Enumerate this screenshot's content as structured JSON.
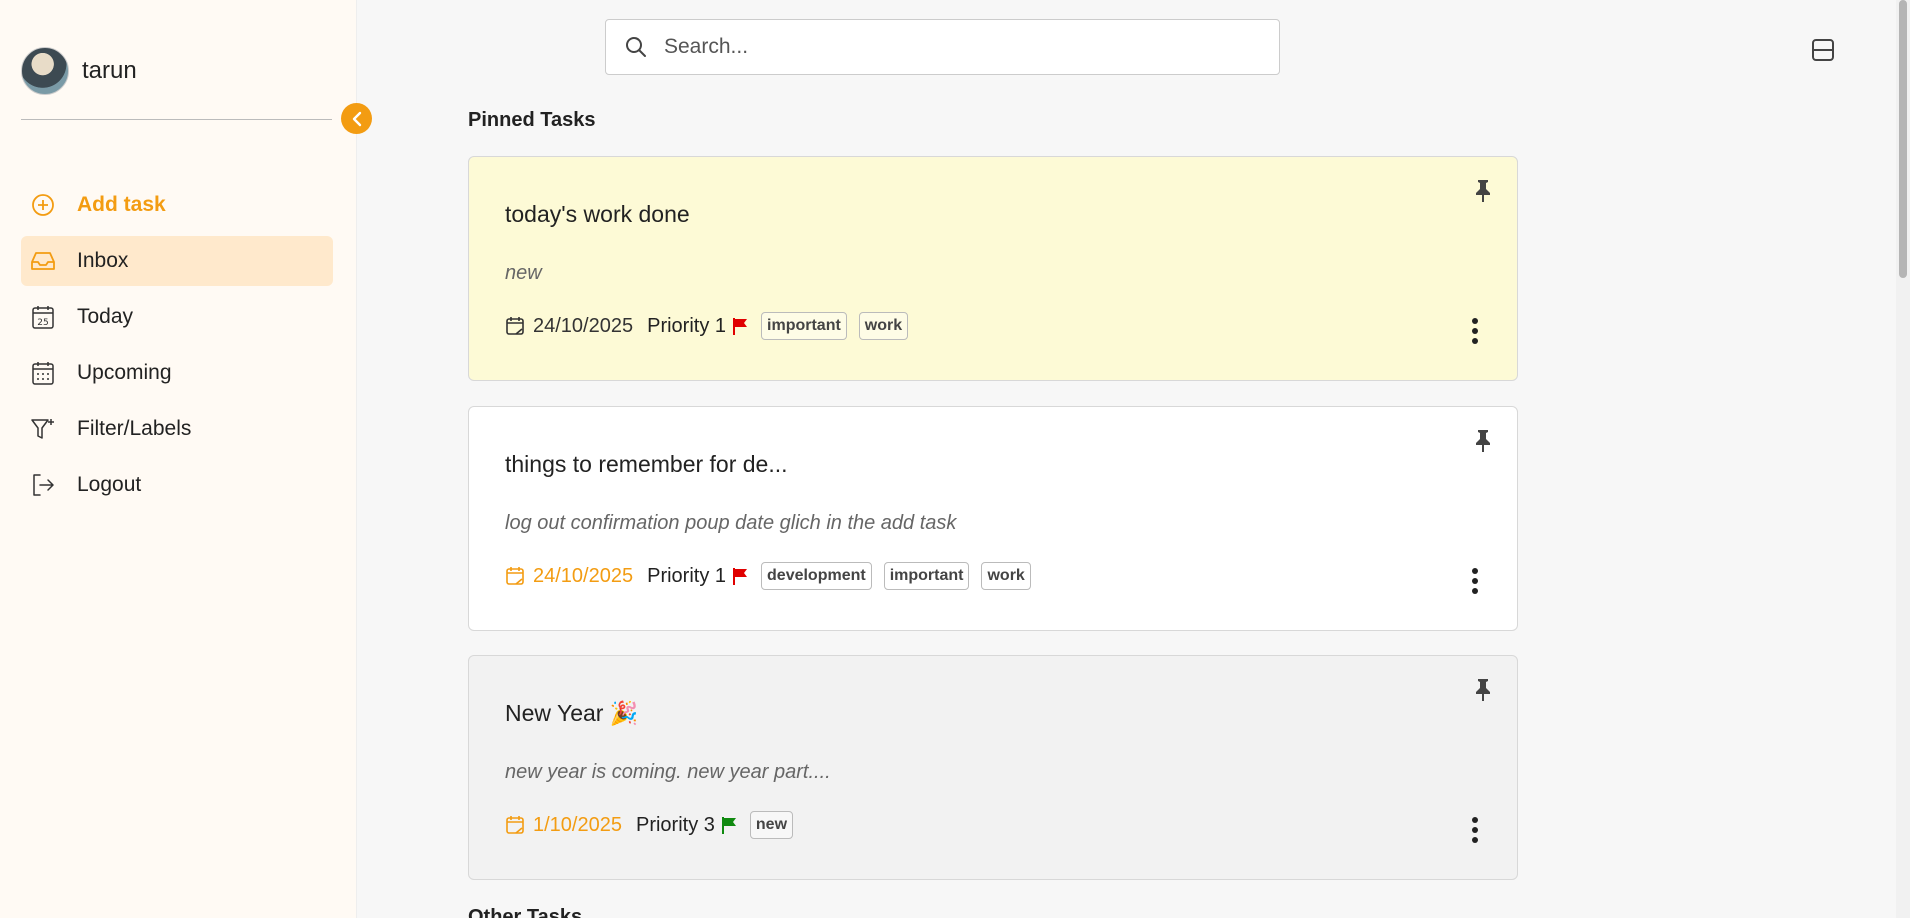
{
  "user": {
    "name": "tarun"
  },
  "nav": {
    "add_task": "Add task",
    "items": [
      {
        "label": "Inbox",
        "icon": "inbox-icon",
        "active": true
      },
      {
        "label": "Today",
        "icon": "calendar-today-icon"
      },
      {
        "label": "Upcoming",
        "icon": "calendar-grid-icon"
      },
      {
        "label": "Filter/Labels",
        "icon": "filter-icon"
      },
      {
        "label": "Logout",
        "icon": "logout-icon"
      }
    ],
    "today_day_number": "25"
  },
  "search": {
    "placeholder": "Search..."
  },
  "sections": {
    "pinned_title": "Pinned Tasks",
    "other_title": "Other Tasks"
  },
  "tasks": [
    {
      "title": "today's work done",
      "description": "new",
      "date": "24/10/2025",
      "priority": "Priority 1",
      "flag_color": "#e00000",
      "tags": [
        "important",
        "work"
      ],
      "bg": "#fdfad6"
    },
    {
      "title": "things to remember for de...",
      "description": "log out confirmation poup date glich in the add task",
      "date": "24/10/2025",
      "priority": "Priority 1",
      "flag_color": "#e00000",
      "tags": [
        "development",
        "important",
        "work"
      ],
      "bg": "#ffffff"
    },
    {
      "title": "New Year 🎉",
      "description": "new year is coming. new year part....",
      "date": "1/10/2025",
      "priority": "Priority 3",
      "flag_color": "#108a10",
      "tags": [
        "new"
      ],
      "bg": "#f2f2f2"
    }
  ],
  "colors": {
    "accent": "#f39c12",
    "date_overdue": "#f39c12",
    "date_normal": "#333333"
  }
}
